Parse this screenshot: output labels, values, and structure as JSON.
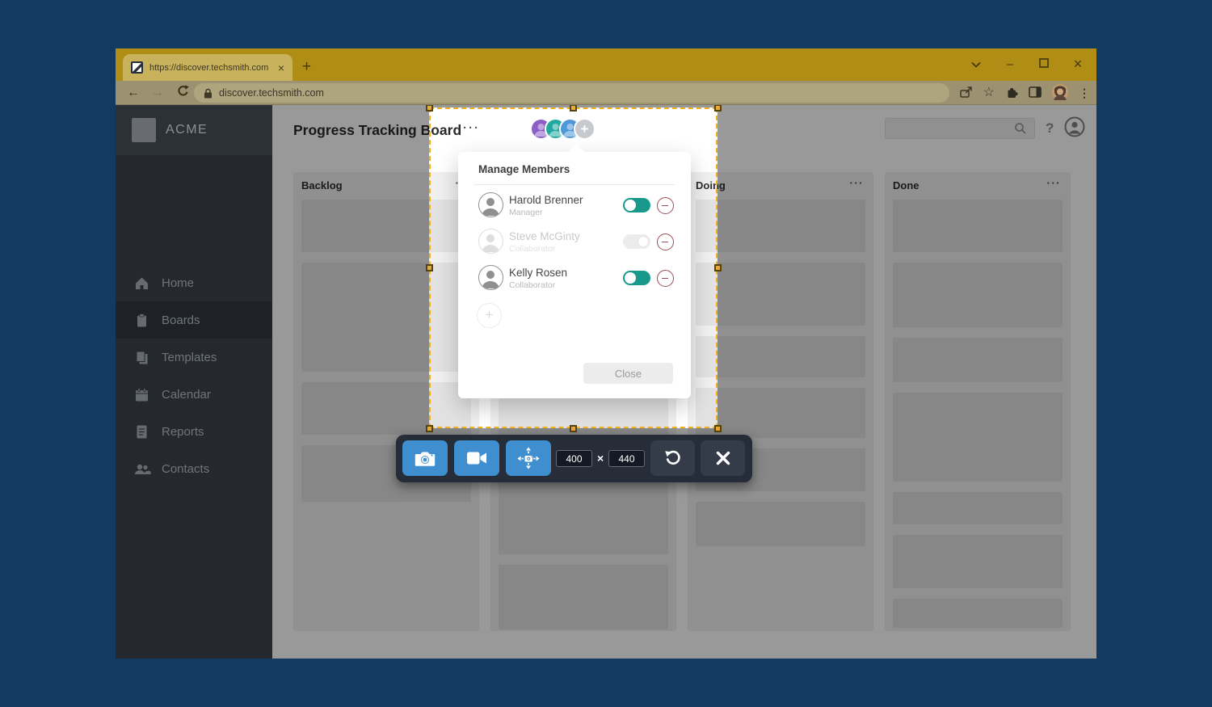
{
  "browser": {
    "tab_title": "https://discover.techsmith.com",
    "tab_close_glyph": "×",
    "new_tab_glyph": "+",
    "url": "discover.techsmith.com",
    "window_controls": {
      "minimize_glyph": "–",
      "close_glyph": "×"
    },
    "back_glyph": "←",
    "forward_glyph": "→",
    "star_glyph": "☆",
    "menu_dots_glyph": "⋮"
  },
  "sidebar": {
    "brand": "ACME",
    "items": [
      {
        "label": "Home",
        "icon": "home-icon",
        "active": false
      },
      {
        "label": "Boards",
        "icon": "boards-icon",
        "active": true
      },
      {
        "label": "Templates",
        "icon": "templates-icon",
        "active": false
      },
      {
        "label": "Calendar",
        "icon": "calendar-icon",
        "active": false
      },
      {
        "label": "Reports",
        "icon": "reports-icon",
        "active": false
      },
      {
        "label": "Contacts",
        "icon": "contacts-icon",
        "active": false
      }
    ]
  },
  "header": {
    "title": "Progress Tracking Board",
    "menu_dots": "···",
    "help_glyph": "?",
    "avatars": [
      {
        "name": "member-avatar-purple",
        "color": "#8b5fc7"
      },
      {
        "name": "member-avatar-teal",
        "color": "#1fa9a0"
      },
      {
        "name": "member-avatar-blue",
        "color": "#4e97d8"
      },
      {
        "name": "add-member-avatar",
        "color": "#c6cacf",
        "glyph": "+"
      }
    ]
  },
  "board": {
    "columns": [
      {
        "name": "Backlog",
        "menu": "···",
        "cards": [
          65,
          135,
          65,
          70
        ]
      },
      {
        "name": "",
        "menu": "",
        "cards": [
          65,
          135,
          65,
          135,
          80
        ]
      },
      {
        "name": "Doing",
        "menu": "···",
        "cards": [
          65,
          78,
          51,
          62,
          53,
          55
        ]
      },
      {
        "name": "Done",
        "menu": "···",
        "cards": [
          65,
          80,
          55,
          110,
          40,
          66,
          36
        ]
      }
    ]
  },
  "popup": {
    "title": "Manage Members",
    "members": [
      {
        "name": "Harold Brenner",
        "role": "Manager",
        "enabled": true,
        "muted": false
      },
      {
        "name": "Steve McGinty",
        "role": "Collaborator",
        "enabled": false,
        "muted": true
      },
      {
        "name": "Kelly Rosen",
        "role": "Collaborator",
        "enabled": true,
        "muted": false
      }
    ],
    "add_glyph": "+",
    "close_label": "Close"
  },
  "capture": {
    "width_value": "400",
    "height_value": "440",
    "times_glyph": "×",
    "accent_color": "#f2b01e",
    "button_color": "#3f8fd0"
  }
}
